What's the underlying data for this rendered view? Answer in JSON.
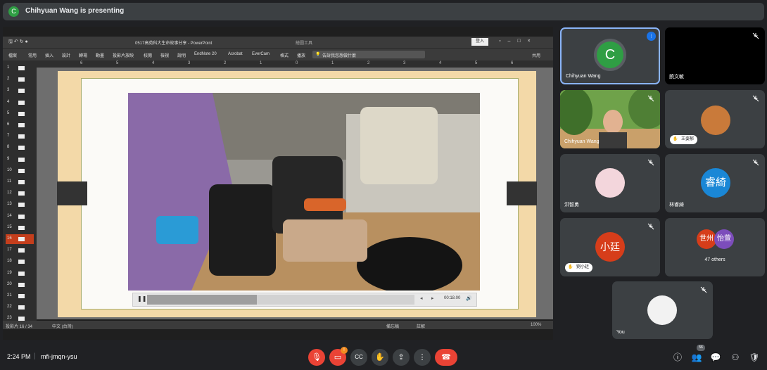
{
  "presenting": {
    "avatar_letter": "C",
    "text": "Chihyuan Wang is presenting"
  },
  "powerpoint": {
    "doc_title": "0517高苑科大生命故事分享 - PowerPoint",
    "tools_label": "繪圖工具",
    "login": "登入",
    "menu": [
      "檔案",
      "常用",
      "插入",
      "設計",
      "轉場",
      "動畫",
      "投影片放映",
      "校閱",
      "檢視",
      "說明",
      "EndNote 20",
      "Acrobat",
      "EverCam",
      "格式",
      "播放"
    ],
    "search_placeholder": "告訴我您想做什麼",
    "share_label": "共用",
    "ruler": [
      "6",
      "5",
      "4",
      "3",
      "2",
      "1",
      "0",
      "1",
      "2",
      "3",
      "4",
      "5",
      "6"
    ],
    "slide_numbers": [
      "1",
      "2",
      "3",
      "4",
      "5",
      "6",
      "7",
      "8",
      "9",
      "10",
      "11",
      "12",
      "13",
      "14",
      "15",
      "16",
      "17",
      "18",
      "19",
      "20",
      "21",
      "22",
      "23"
    ],
    "video_time": "00:18.00",
    "video_progress": 0.41,
    "status_slide": "投影片 16 / 34",
    "status_lang": "中文 (台灣)",
    "status_notes": "備忘稿",
    "status_comments": "註解",
    "zoom": "100%"
  },
  "participants": [
    {
      "name": "Chihyuan Wang",
      "letter": "C",
      "color": "#2f9e44"
    },
    {
      "name": "饒文敏"
    },
    {
      "name": "Chihyuan Wang"
    },
    {
      "name": "王姿郁"
    },
    {
      "name": "洪智勇"
    },
    {
      "name": "林睿綺",
      "letter": "睿綺",
      "color": "#1a87d6"
    },
    {
      "name": "劉小廷",
      "letter": "小廷",
      "color": "#d63d1a"
    },
    {
      "others": "47 others",
      "a": "世州",
      "a_color": "#d63d1a",
      "b": "怡萱",
      "b_color": "#7c4dbb"
    },
    {
      "name": "You"
    }
  ],
  "bottom": {
    "time": "2:24 PM",
    "meeting_code": "mfi-jmqn-ysu",
    "people_count": "56",
    "notif_count": "!"
  }
}
